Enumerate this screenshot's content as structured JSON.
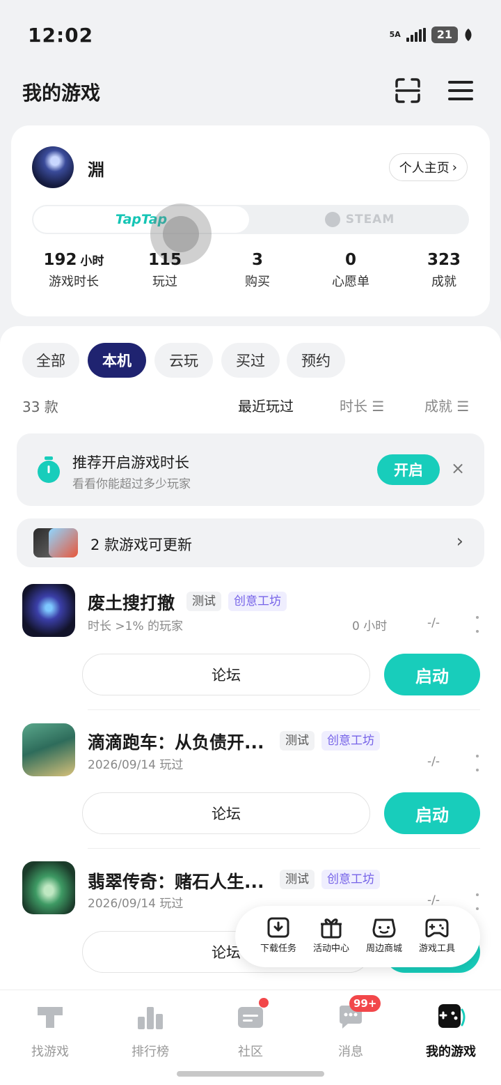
{
  "status_bar": {
    "time": "12:02",
    "network": "5A",
    "battery": "21"
  },
  "header": {
    "title": "我的游戏",
    "scan_icon": "scan-icon",
    "menu_icon": "menu-icon"
  },
  "profile": {
    "username": "淵",
    "homepage_label": "个人主页",
    "platforms": [
      "TapTap",
      "STEAM"
    ],
    "stats": [
      {
        "value": "192",
        "unit": "小时",
        "label": "游戏时长"
      },
      {
        "value": "115",
        "unit": "",
        "label": "玩过"
      },
      {
        "value": "3",
        "unit": "",
        "label": "购买"
      },
      {
        "value": "0",
        "unit": "",
        "label": "心愿单"
      },
      {
        "value": "323",
        "unit": "",
        "label": "成就"
      }
    ]
  },
  "filters": {
    "chips": [
      "全部",
      "本机",
      "云玩",
      "买过",
      "预约"
    ],
    "active": "本机"
  },
  "sort_bar": {
    "count": "33 款",
    "options": [
      "最近玩过",
      "时长 ☰",
      "成就 ☰"
    ]
  },
  "banner": {
    "title": "推荐开启游戏时长",
    "subtitle": "看看你能超过多少玩家",
    "button": "开启",
    "close": "×"
  },
  "update_row": {
    "text": "2 款游戏可更新"
  },
  "games": [
    {
      "title": "废土搜打撤",
      "tags": [
        "测试",
        "创意工坊"
      ],
      "subtitle": "时长 >1% 的玩家",
      "hours": "0 小时",
      "achievements": "-/-",
      "forum": "论坛",
      "launch": "启动"
    },
    {
      "title": "滴滴跑车：从负债开...",
      "tags": [
        "测试",
        "创意工坊"
      ],
      "subtitle": "2026/09/14 玩过",
      "hours": "",
      "achievements": "-/-",
      "forum": "论坛",
      "launch": "启动"
    },
    {
      "title": "翡翠传奇：赌石人生...",
      "tags": [
        "测试",
        "创意工坊"
      ],
      "subtitle": "2026/09/14 玩过",
      "hours": "",
      "achievements": "-/-",
      "forum": "论坛",
      "launch": "启动"
    }
  ],
  "quick_menu": [
    "下载任务",
    "活动中心",
    "周边商城",
    "游戏工具"
  ],
  "bottom_nav": {
    "items": [
      "找游戏",
      "排行榜",
      "社区",
      "消息",
      "我的游戏"
    ],
    "active": "我的游戏",
    "messages_badge": "99+"
  },
  "colors": {
    "accent": "#18cdbb",
    "chip_active": "#1f2370",
    "workshop_tag": "#7663e8",
    "badge": "#f2474a"
  }
}
